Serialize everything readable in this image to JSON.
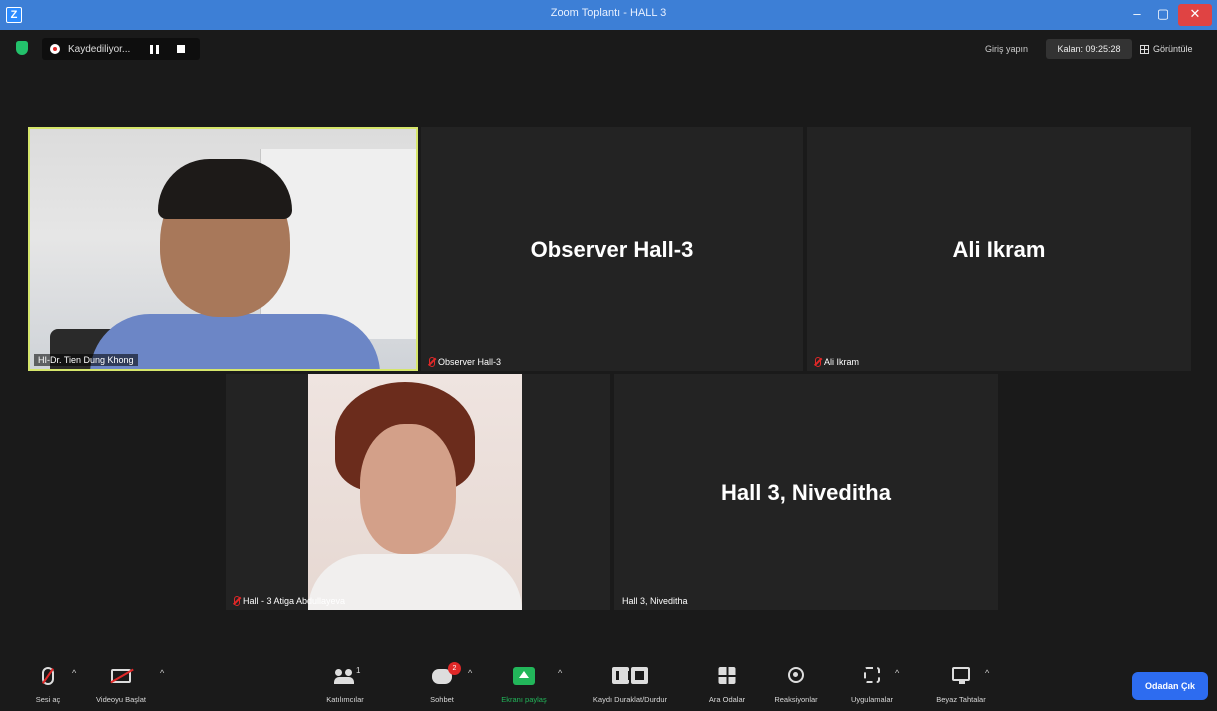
{
  "window": {
    "title": "Zoom Toplantı - HALL 3",
    "app_icon": "Z",
    "min": "–",
    "max": "▢",
    "close": "✕"
  },
  "topbar": {
    "recording_label": "Kaydediliyor...",
    "login": "Giriş yapın",
    "time_remaining": "Kalan: 09:25:28",
    "view": "Görüntüle"
  },
  "tiles": [
    {
      "label": "HI-Dr. Tien Dung Khong",
      "muted": false,
      "active_speaker": true,
      "video": true
    },
    {
      "label": "Observer Hall-3",
      "center_name": "Observer Hall-3",
      "muted": true
    },
    {
      "label": "Ali Ikram",
      "center_name": "Ali Ikram",
      "muted": true
    },
    {
      "label": "Hall - 3 Atiga Abdullayeva",
      "muted": true,
      "video": true
    },
    {
      "label": "Hall 3, Niveditha",
      "center_name": "Hall 3, Niveditha",
      "muted": false
    }
  ],
  "toolbar": {
    "mic": "Sesi aç",
    "video": "Videoyu Başlat",
    "participants": "Katılımcılar",
    "participants_count": "1",
    "chat": "Sohbet",
    "chat_badge": "2",
    "share": "Ekranı paylaş",
    "record": "Kaydı Duraklat/Durdur",
    "rooms": "Ara Odalar",
    "reactions": "Reaksiyonlar",
    "apps": "Uygulamalar",
    "whiteboard": "Beyaz Tahtalar",
    "leave": "Odadan Çık"
  },
  "colors": {
    "active_speaker_border": "#d6e66b",
    "share_green": "#22b65a",
    "leave_blue": "#2d6cf0",
    "muted_red": "#e02828",
    "titlebar": "#3d7fd6"
  }
}
